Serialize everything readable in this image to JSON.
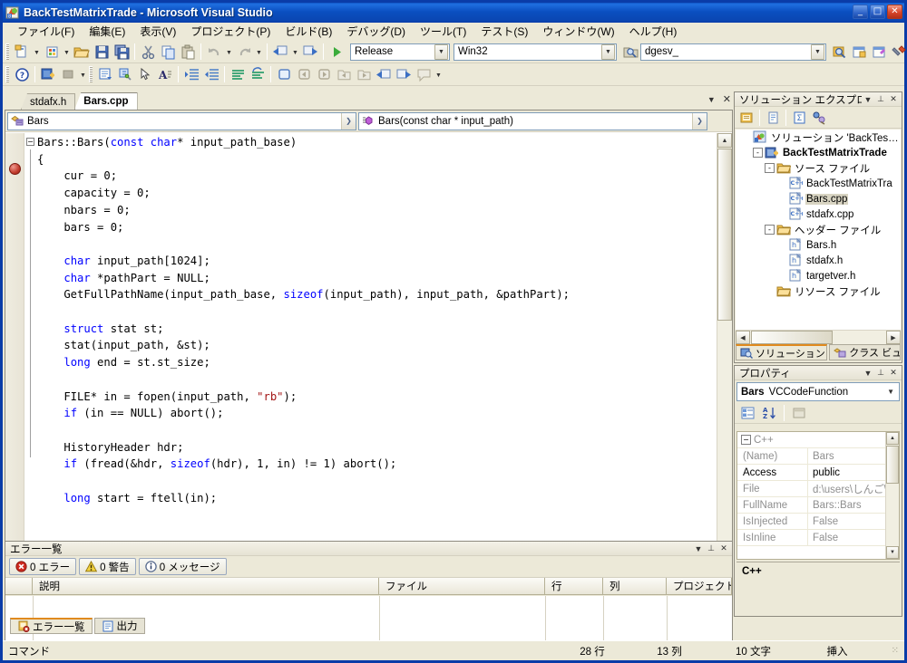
{
  "window": {
    "title": "BackTestMatrixTrade - Microsoft Visual Studio",
    "minimize": "_",
    "maximize": "□",
    "close": "✕"
  },
  "menu": [
    {
      "label": "ファイル(F)",
      "name": "menu-file"
    },
    {
      "label": "編集(E)",
      "name": "menu-edit"
    },
    {
      "label": "表示(V)",
      "name": "menu-view"
    },
    {
      "label": "プロジェクト(P)",
      "name": "menu-project"
    },
    {
      "label": "ビルド(B)",
      "name": "menu-build"
    },
    {
      "label": "デバッグ(D)",
      "name": "menu-debug"
    },
    {
      "label": "ツール(T)",
      "name": "menu-tools"
    },
    {
      "label": "テスト(S)",
      "name": "menu-test"
    },
    {
      "label": "ウィンドウ(W)",
      "name": "menu-window"
    },
    {
      "label": "ヘルプ(H)",
      "name": "menu-help"
    }
  ],
  "toolbar": {
    "config_value": "Release",
    "platform_value": "Win32",
    "find_value": "dgesv_",
    "run_tooltip": "開始",
    "icons": [
      "new-project-icon",
      "add-new-item-icon",
      "open-file-icon",
      "save-icon",
      "save-all-icon",
      "cut-icon",
      "copy-icon",
      "paste-icon",
      "undo-icon",
      "redo-icon",
      "navigate-back-icon",
      "navigate-forward-icon",
      "start-debug-icon",
      "find-in-files-icon",
      "new-window-icon",
      "properties-window-icon",
      "toolbox-icon"
    ],
    "row2_icons": [
      "help-icon",
      "add-resource-icon",
      "stop-icon",
      "code-definition-icon",
      "object-browser-icon",
      "pointer-icon",
      "font-icon",
      "indent-icon",
      "outdent-icon",
      "comment-icon",
      "uncomment-icon",
      "toggle-bookmark-icon",
      "prev-bookmark-icon",
      "next-bookmark-icon",
      "clear-bookmarks-icon",
      "folder-bookmark-icon",
      "prev-location-icon",
      "next-location-icon",
      "callout-icon"
    ]
  },
  "doc_tabs": [
    {
      "label": "stdafx.h",
      "active": false
    },
    {
      "label": "Bars.cpp",
      "active": true
    }
  ],
  "editor": {
    "nav_class": "Bars",
    "nav_member": "Bars(const char * input_path)",
    "status": {
      "line_label": "28 行",
      "col_label": "13 列",
      "char_label": "10 文字",
      "insert_mode": "挿入",
      "command_label": "コマンド"
    },
    "code_lines": [
      [
        {
          "t": "Bars::Bars(",
          "c": ""
        },
        {
          "t": "const",
          "c": "kw"
        },
        {
          "t": " ",
          "c": ""
        },
        {
          "t": "char",
          "c": "kw"
        },
        {
          "t": "* input_path_base)",
          "c": ""
        }
      ],
      [
        {
          "t": "{",
          "c": ""
        }
      ],
      [
        {
          "t": "    cur = 0;",
          "c": ""
        }
      ],
      [
        {
          "t": "    capacity = 0;",
          "c": ""
        }
      ],
      [
        {
          "t": "    nbars = 0;",
          "c": ""
        }
      ],
      [
        {
          "t": "    bars = 0;",
          "c": ""
        }
      ],
      [
        {
          "t": "",
          "c": ""
        }
      ],
      [
        {
          "t": "    ",
          "c": ""
        },
        {
          "t": "char",
          "c": "kw"
        },
        {
          "t": " input_path[1024];",
          "c": ""
        }
      ],
      [
        {
          "t": "    ",
          "c": ""
        },
        {
          "t": "char",
          "c": "kw"
        },
        {
          "t": " *pathPart = NULL;",
          "c": ""
        }
      ],
      [
        {
          "t": "    GetFullPathName(input_path_base, ",
          "c": ""
        },
        {
          "t": "sizeof",
          "c": "kw"
        },
        {
          "t": "(input_path), input_path, &pathPart);",
          "c": ""
        }
      ],
      [
        {
          "t": "",
          "c": ""
        }
      ],
      [
        {
          "t": "    ",
          "c": ""
        },
        {
          "t": "struct",
          "c": "kw"
        },
        {
          "t": " stat st;",
          "c": ""
        }
      ],
      [
        {
          "t": "    stat(input_path, &st);",
          "c": ""
        }
      ],
      [
        {
          "t": "    ",
          "c": ""
        },
        {
          "t": "long",
          "c": "kw"
        },
        {
          "t": " end = st.st_size;",
          "c": ""
        }
      ],
      [
        {
          "t": "",
          "c": ""
        }
      ],
      [
        {
          "t": "    FILE* in = fopen(input_path, ",
          "c": ""
        },
        {
          "t": "\"rb\"",
          "c": "str"
        },
        {
          "t": ");",
          "c": ""
        }
      ],
      [
        {
          "t": "    ",
          "c": ""
        },
        {
          "t": "if",
          "c": "kw"
        },
        {
          "t": " (in == NULL) abort();",
          "c": ""
        }
      ],
      [
        {
          "t": "",
          "c": ""
        }
      ],
      [
        {
          "t": "    HistoryHeader hdr;",
          "c": ""
        }
      ],
      [
        {
          "t": "    ",
          "c": ""
        },
        {
          "t": "if",
          "c": "kw"
        },
        {
          "t": " (fread(&hdr, ",
          "c": ""
        },
        {
          "t": "sizeof",
          "c": "kw"
        },
        {
          "t": "(hdr), 1, in) != 1) abort();",
          "c": ""
        }
      ],
      [
        {
          "t": "",
          "c": ""
        }
      ],
      [
        {
          "t": "    ",
          "c": ""
        },
        {
          "t": "long",
          "c": "kw"
        },
        {
          "t": " start = ftell(in);",
          "c": ""
        }
      ]
    ]
  },
  "error_list": {
    "title": "エラー一覧",
    "buttons": [
      {
        "label": "0 エラー",
        "icon": "error-icon",
        "name": "filter-errors-button"
      },
      {
        "label": "0 警告",
        "icon": "warning-icon",
        "name": "filter-warnings-button"
      },
      {
        "label": "0 メッセージ",
        "icon": "info-icon",
        "name": "filter-messages-button"
      }
    ],
    "columns": [
      "",
      "説明",
      "ファイル",
      "行",
      "列",
      "プロジェクト"
    ],
    "rows": []
  },
  "bottom_tabs": [
    {
      "label": "エラー一覧",
      "icon": "error-list-icon",
      "active": true
    },
    {
      "label": "出力",
      "icon": "output-icon",
      "active": false
    }
  ],
  "solution_explorer": {
    "title": "ソリューション エクスプローラ_",
    "toolbar_icons": [
      "properties-icon",
      "show-all-files-icon",
      "view-code-icon",
      "view-class-diagram-icon"
    ],
    "tree": [
      {
        "depth": 0,
        "label": "ソリューション 'BackTestMatrixT",
        "icon": "solution-icon",
        "exp": null,
        "bold": false,
        "sel": false
      },
      {
        "depth": 1,
        "label": "BackTestMatrixTrade",
        "icon": "project-icon",
        "exp": "-",
        "bold": true,
        "sel": false
      },
      {
        "depth": 2,
        "label": "ソース ファイル",
        "icon": "folder-icon",
        "exp": "-",
        "bold": false,
        "sel": false
      },
      {
        "depth": 3,
        "label": "BackTestMatrixTra",
        "icon": "cpp-icon",
        "exp": null,
        "bold": false,
        "sel": false
      },
      {
        "depth": 3,
        "label": "Bars.cpp",
        "icon": "cpp-icon",
        "exp": null,
        "bold": false,
        "sel": true
      },
      {
        "depth": 3,
        "label": "stdafx.cpp",
        "icon": "cpp-icon",
        "exp": null,
        "bold": false,
        "sel": false
      },
      {
        "depth": 2,
        "label": "ヘッダー ファイル",
        "icon": "folder-icon",
        "exp": "-",
        "bold": false,
        "sel": false
      },
      {
        "depth": 3,
        "label": "Bars.h",
        "icon": "header-icon",
        "exp": null,
        "bold": false,
        "sel": false
      },
      {
        "depth": 3,
        "label": "stdafx.h",
        "icon": "header-icon",
        "exp": null,
        "bold": false,
        "sel": false
      },
      {
        "depth": 3,
        "label": "targetver.h",
        "icon": "header-icon",
        "exp": null,
        "bold": false,
        "sel": false
      },
      {
        "depth": 2,
        "label": "リソース ファイル",
        "icon": "folder-icon",
        "exp": null,
        "bold": false,
        "sel": false
      }
    ],
    "tabs": [
      {
        "label": "ソリューション エ_",
        "icon": "solution-explorer-icon",
        "active": true
      },
      {
        "label": "クラス ビュー",
        "icon": "class-view-icon",
        "active": false
      }
    ]
  },
  "properties": {
    "title": "プロパティ",
    "object_name": "Bars",
    "object_type": "VCCodeFunction",
    "toolbar_icons": [
      "categorized-icon",
      "alphabetical-icon",
      "property-pages-icon"
    ],
    "category": "C++",
    "rows": [
      {
        "name": "(Name)",
        "value": "Bars",
        "hl": false
      },
      {
        "name": "Access",
        "value": "public",
        "hl": true
      },
      {
        "name": "File",
        "value": "d:\\users\\しんご\\",
        "hl": false
      },
      {
        "name": "FullName",
        "value": "Bars::Bars",
        "hl": false
      },
      {
        "name": "IsInjected",
        "value": "False",
        "hl": false
      },
      {
        "name": "IsInline",
        "value": "False",
        "hl": false
      }
    ],
    "description": "C++"
  },
  "colors": {
    "accent": "#0a3ca8",
    "chrome": "#ece9d8",
    "keyword": "#0000ff",
    "string": "#a31515",
    "selection": "#d8d4c2",
    "tab_active_underline": "#e08a1e"
  }
}
